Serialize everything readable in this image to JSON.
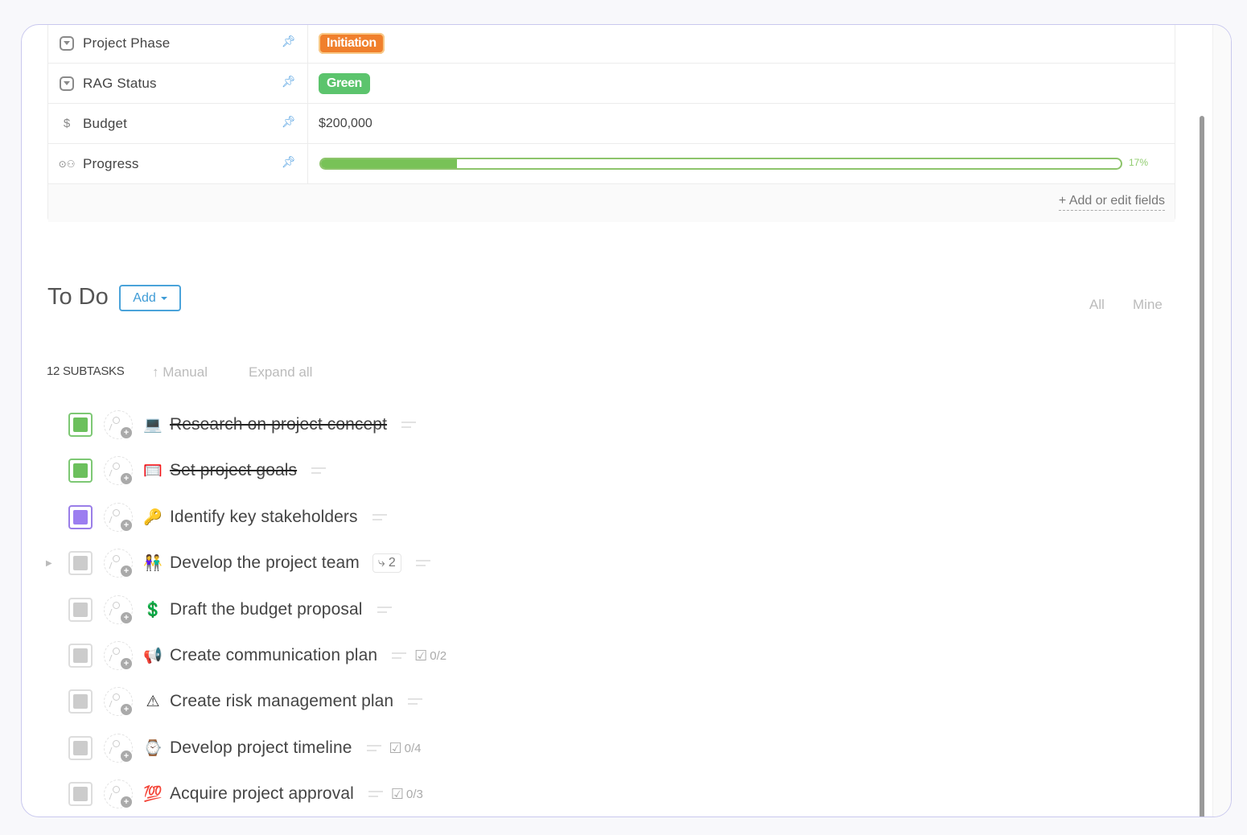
{
  "fields": [
    {
      "name": "Project Phase",
      "icon": "dropdown-icon",
      "type": "badge",
      "value": "Initiation",
      "color": "#f07f2c"
    },
    {
      "name": "RAG Status",
      "icon": "dropdown-icon",
      "type": "badge",
      "value": "Green",
      "color": "#5cc46d"
    },
    {
      "name": "Budget",
      "icon": "dollar-icon",
      "type": "text",
      "value": "$200,000"
    },
    {
      "name": "Progress",
      "icon": "progress-icon",
      "type": "progress",
      "value": 17,
      "label": "17%"
    }
  ],
  "fields_footer": {
    "add_edit_label": "+ Add or edit fields"
  },
  "todo": {
    "title": "To Do",
    "add_label": "Add",
    "filters": {
      "all": "All",
      "mine": "Mine"
    },
    "subtasks_count": "12 SUBTASKS",
    "sort_label": "Manual",
    "expand_label": "Expand all"
  },
  "tasks": [
    {
      "name": "Research on project concept",
      "emoji": "💻",
      "status": "done",
      "completed": true
    },
    {
      "name": "Set project goals",
      "emoji": "🥅",
      "status": "done",
      "completed": true
    },
    {
      "name": "Identify key stakeholders",
      "emoji": "🔑",
      "status": "in-progress",
      "completed": false
    },
    {
      "name": "Develop the project team",
      "emoji": "👫",
      "status": "todo",
      "completed": false,
      "subtasks": "2",
      "expandable": true
    },
    {
      "name": "Draft the budget proposal",
      "emoji": "💲",
      "status": "todo",
      "completed": false
    },
    {
      "name": "Create communication plan",
      "emoji": "📢",
      "status": "todo",
      "completed": false,
      "checklist": "0/2"
    },
    {
      "name": "Create risk management plan",
      "emoji": "⚠",
      "status": "todo",
      "completed": false
    },
    {
      "name": "Develop project timeline",
      "emoji": "⌚",
      "status": "todo",
      "completed": false,
      "checklist": "0/4"
    },
    {
      "name": "Acquire project approval",
      "emoji": "💯",
      "status": "todo",
      "completed": false,
      "checklist": "0/3"
    }
  ]
}
